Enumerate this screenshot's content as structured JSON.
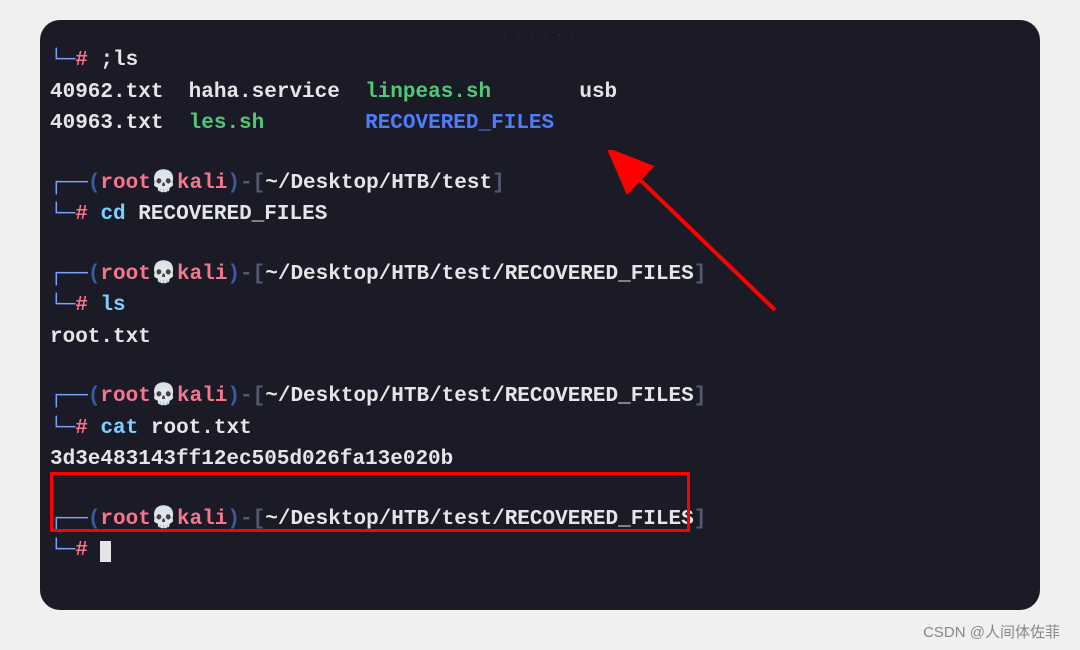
{
  "prompt": {
    "user": "root",
    "skull": "💀",
    "host": "kali",
    "sep_open": "(",
    "sep_close": ")",
    "dash_open": "-[",
    "dash_close": "]",
    "path1": "~/Desktop/HTB/test",
    "path2": "~/Desktop/HTB/test/RECOVERED_FILES",
    "hash": "#",
    "corner_top": "┌──",
    "corner_bot": "└─"
  },
  "commands": {
    "cmd0": ";ls",
    "cmd1": "cd",
    "cmd1_arg": "RECOVERED_FILES",
    "cmd2": "ls",
    "cmd3": "cat",
    "cmd3_arg": "root.txt"
  },
  "ls_output": {
    "row1": {
      "c1": "40962.txt",
      "c2": "haha.service",
      "c3": "linpeas.sh",
      "c4": "usb"
    },
    "row2": {
      "c1": "40963.txt",
      "c2": "les.sh",
      "c3": "RECOVERED_FILES"
    }
  },
  "ls2_output": "root.txt",
  "cat_output": "3d3e483143ff12ec505d026fa13e020b",
  "watermark": "CSDN @人间体佐菲",
  "drag": "· · · · · ·"
}
